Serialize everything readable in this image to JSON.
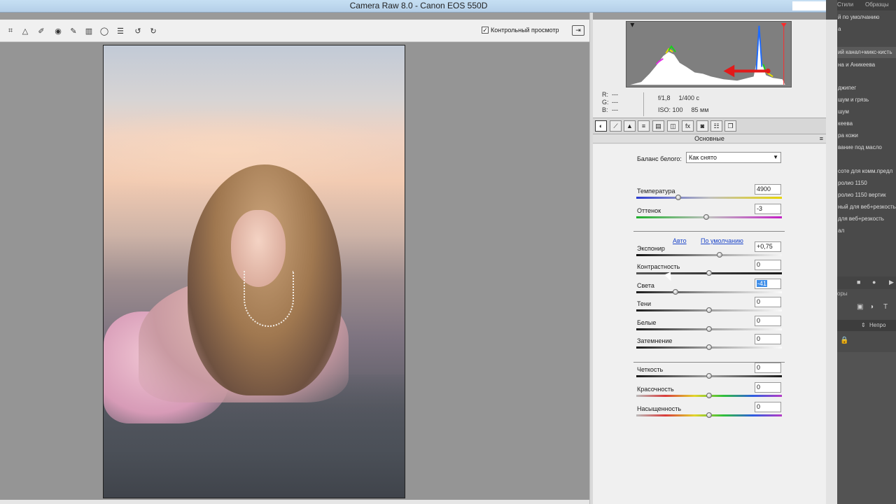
{
  "window": {
    "title": "Camera Raw 8.0  -  Canon EOS 550D"
  },
  "toolbar": {
    "tools": [
      {
        "name": "crop-tool-icon",
        "glyph": "⌗"
      },
      {
        "name": "straighten-tool-icon",
        "glyph": "△"
      },
      {
        "name": "spot-removal-tool-icon",
        "glyph": "✐"
      },
      {
        "name": "red-eye-tool-icon",
        "glyph": "◉"
      },
      {
        "name": "adjustment-brush-icon",
        "glyph": "✎"
      },
      {
        "name": "graduated-filter-icon",
        "glyph": "▥"
      },
      {
        "name": "radial-filter-icon",
        "glyph": "◯"
      },
      {
        "name": "preferences-icon",
        "glyph": "☰"
      },
      {
        "name": "rotate-ccw-icon",
        "glyph": "↺"
      },
      {
        "name": "rotate-cw-icon",
        "glyph": "↻"
      }
    ],
    "preview_checked": true,
    "preview_label": "Контрольный просмотр",
    "fullscreen_glyph": "⇥"
  },
  "histogram": {
    "rgb": [
      {
        "ch": "R:",
        "val": "---"
      },
      {
        "ch": "G:",
        "val": "---"
      },
      {
        "ch": "B:",
        "val": "---"
      }
    ],
    "aperture": "f/1,8",
    "shutter": "1/400 с",
    "iso": "ISO: 100",
    "focal": "85 мм"
  },
  "panel_tabs": [
    {
      "name": "tab-basic-icon",
      "glyph": "◐"
    },
    {
      "name": "tab-tone-curve-icon",
      "glyph": "⟋"
    },
    {
      "name": "tab-detail-icon",
      "glyph": "▲"
    },
    {
      "name": "tab-hsl-icon",
      "glyph": "≡"
    },
    {
      "name": "tab-split-toning-icon",
      "glyph": "▤"
    },
    {
      "name": "tab-lens-corrections-icon",
      "glyph": "◫"
    },
    {
      "name": "tab-effects-icon",
      "glyph": "fx"
    },
    {
      "name": "tab-camera-calibration-icon",
      "glyph": "◙"
    },
    {
      "name": "tab-presets-icon",
      "glyph": "☷"
    },
    {
      "name": "tab-snapshots-icon",
      "glyph": "❐"
    }
  ],
  "basic_panel": {
    "title": "Основные",
    "white_balance_label": "Баланс белого:",
    "white_balance_value": "Как снято",
    "auto_link": "Авто",
    "default_link": "По умолчанию",
    "sliders": [
      {
        "label": "Температура",
        "value": "4900",
        "position": 0.29,
        "gradient": "linear-gradient(90deg,#2b3bd0,#c0c0c0,#e7d400)"
      },
      {
        "label": "Оттенок",
        "value": "-3",
        "position": 0.48,
        "gradient": "linear-gradient(90deg,#1db02b,#c0c0c0,#c21fc5)"
      },
      {
        "label": "Экспонир",
        "value": "+0,75",
        "position": 0.57,
        "gradient": "linear-gradient(90deg,#111,#9a9a9a,#f4f4f4)"
      },
      {
        "label": "Контрастность",
        "value": "0",
        "position": 0.5,
        "gradient": "linear-gradient(90deg,#555,#1b1b1b)"
      },
      {
        "label": "Света",
        "value": "-41",
        "position": 0.27,
        "highlight": true,
        "gradient": "linear-gradient(90deg,#1b1b1b,#a0a0a0,#fafafa)"
      },
      {
        "label": "Тени",
        "value": "0",
        "position": 0.5,
        "gradient": "linear-gradient(90deg,#1b1b1b,#a0a0a0,#fafafa)"
      },
      {
        "label": "Белые",
        "value": "0",
        "position": 0.5,
        "gradient": "linear-gradient(90deg,#1b1b1b,#a0a0a0,#fafafa)"
      },
      {
        "label": "Затемнение",
        "value": "0",
        "position": 0.5,
        "gradient": "linear-gradient(90deg,#1b1b1b,#a0a0a0,#fafafa)"
      },
      {
        "label": "Четкость",
        "value": "0",
        "position": 0.5,
        "gradient": "linear-gradient(90deg,#1b1b1b,#a0a0a0,#1b1b1b)"
      },
      {
        "label": "Красочность",
        "value": "0",
        "position": 0.5,
        "gradient": "linear-gradient(90deg,#bbb,#d93b3b,#e3d42a,#2fbf3a,#2c5de0,#b53ac6)"
      },
      {
        "label": "Насыщенность",
        "value": "0",
        "position": 0.5,
        "gradient": "linear-gradient(90deg,#bbb,#d93b3b,#e3d42a,#2fbf3a,#2c5de0,#b53ac6)"
      }
    ]
  },
  "photoshop": {
    "tab1": "Стили",
    "tab2": "Образцы",
    "actions": [
      "й по умолчанию",
      "а",
      "ий канал+микс-кисть",
      "на и Аникеева",
      "",
      "джипег",
      "шум и грязь",
      "шум",
      "кеева",
      "ра кожи",
      "вание под масло",
      "",
      "соте для комм.предл",
      "ролио 1150",
      "ролио 1150 вертик",
      "ный для веб+резкость",
      "для веб+резкость",
      "ал"
    ],
    "layers_label": "оры",
    "opacity_label": "Непро"
  },
  "colors": {
    "accent": "#3f8ee8",
    "link": "#1b45c9"
  }
}
